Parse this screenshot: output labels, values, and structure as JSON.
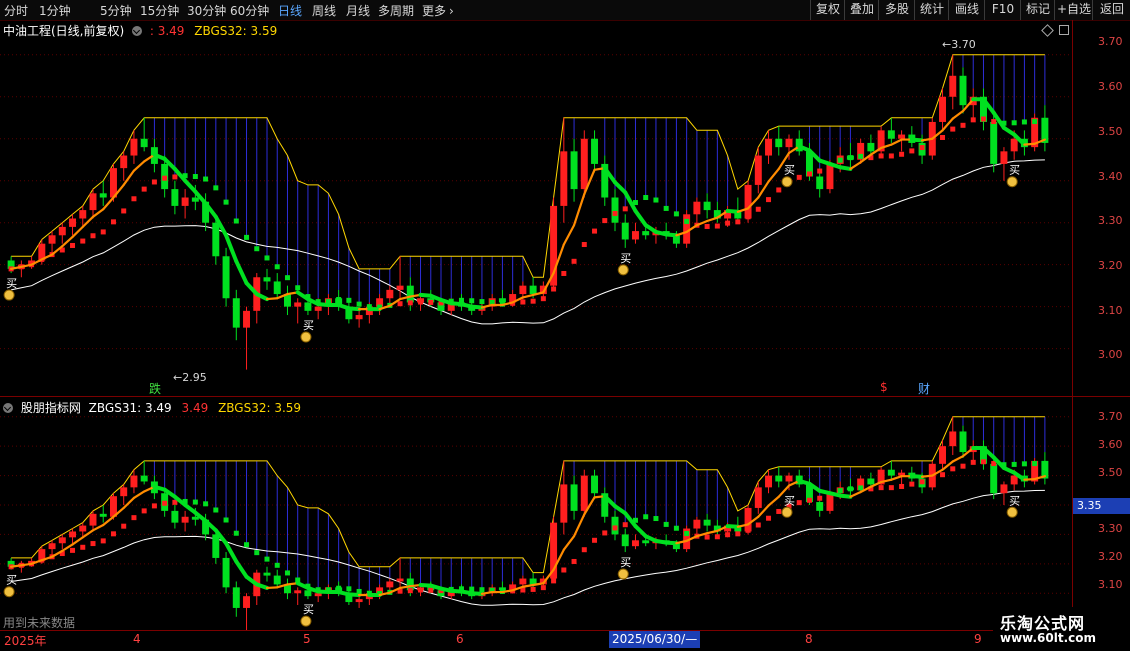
{
  "toolbar": {
    "periods": [
      "分时",
      "1分钟",
      "5分钟",
      "15分钟",
      "30分钟",
      "60分钟",
      "日线",
      "周线",
      "月线",
      "多周期",
      "更多"
    ],
    "active_period": "日线",
    "tools": [
      "复权",
      "叠加",
      "多股",
      "统计",
      "画线",
      "F10",
      "+自选",
      "返回"
    ],
    "more_icon": "chevron-right-icon"
  },
  "main_pane": {
    "title": "中油工程(日线,前复权)",
    "value_a": ": 3.49",
    "indicator_b": "ZBGS32: 3.59",
    "high_label": "3.70",
    "low_label": "2.95",
    "markers": {
      "fall": "跌",
      "dollar": "$",
      "finance": "财"
    },
    "axis": [
      "3.70",
      "3.60",
      "3.50",
      "3.40",
      "3.30",
      "3.20",
      "3.10",
      "3.00"
    ]
  },
  "sub_pane": {
    "title": "股朋指标网",
    "indicator_a": "ZBGS31: 3.49",
    "value_mid": "3.49",
    "indicator_b": "ZBGS32: 3.59",
    "axis": [
      "3.70",
      "3.60",
      "3.50",
      "3.40",
      "3.30",
      "3.20",
      "3.10"
    ],
    "current_price": "3.35",
    "note": "用到未来数据"
  },
  "signal_buy": "买",
  "time_axis": {
    "labels": [
      "2025年",
      "4",
      "5",
      "6",
      "8",
      "9"
    ],
    "cursor_date": "2025/06/30/—"
  },
  "watermark": {
    "name": "乐淘公式网",
    "url": "www.60lt.com"
  },
  "colors": {
    "up": "#ff1f1f",
    "down": "#00e020",
    "ma": "#ffd700",
    "band": "#2d2dd8",
    "orange": "#ff8c00",
    "axis": "#7a0000"
  },
  "chart_data": {
    "type": "candlestick",
    "series_note": "daily OHLC approximated from chart",
    "ylim_main": [
      2.93,
      3.74
    ],
    "ylim_sub": [
      3.06,
      3.74
    ],
    "ohlc": [
      [
        3.21,
        3.22,
        3.18,
        3.19
      ],
      [
        3.19,
        3.21,
        3.17,
        3.2
      ],
      [
        3.2,
        3.22,
        3.19,
        3.21
      ],
      [
        3.21,
        3.26,
        3.2,
        3.25
      ],
      [
        3.25,
        3.28,
        3.23,
        3.27
      ],
      [
        3.27,
        3.3,
        3.25,
        3.29
      ],
      [
        3.29,
        3.32,
        3.27,
        3.31
      ],
      [
        3.31,
        3.34,
        3.29,
        3.33
      ],
      [
        3.33,
        3.38,
        3.31,
        3.37
      ],
      [
        3.37,
        3.4,
        3.34,
        3.36
      ],
      [
        3.36,
        3.44,
        3.35,
        3.43
      ],
      [
        3.43,
        3.47,
        3.4,
        3.46
      ],
      [
        3.46,
        3.52,
        3.44,
        3.5
      ],
      [
        3.5,
        3.55,
        3.47,
        3.48
      ],
      [
        3.48,
        3.5,
        3.42,
        3.44
      ],
      [
        3.44,
        3.46,
        3.36,
        3.38
      ],
      [
        3.38,
        3.4,
        3.32,
        3.34
      ],
      [
        3.34,
        3.38,
        3.31,
        3.36
      ],
      [
        3.36,
        3.39,
        3.33,
        3.35
      ],
      [
        3.35,
        3.37,
        3.28,
        3.3
      ],
      [
        3.3,
        3.32,
        3.2,
        3.22
      ],
      [
        3.22,
        3.24,
        3.1,
        3.12
      ],
      [
        3.12,
        3.14,
        3.02,
        3.05
      ],
      [
        3.05,
        3.1,
        2.95,
        3.09
      ],
      [
        3.09,
        3.18,
        3.06,
        3.17
      ],
      [
        3.17,
        3.19,
        3.14,
        3.16
      ],
      [
        3.16,
        3.18,
        3.12,
        3.13
      ],
      [
        3.13,
        3.15,
        3.08,
        3.1
      ],
      [
        3.1,
        3.12,
        3.06,
        3.11
      ],
      [
        3.11,
        3.13,
        3.08,
        3.09
      ],
      [
        3.09,
        3.12,
        3.07,
        3.1
      ],
      [
        3.1,
        3.13,
        3.08,
        3.12
      ],
      [
        3.12,
        3.14,
        3.09,
        3.1
      ],
      [
        3.1,
        3.12,
        3.06,
        3.07
      ],
      [
        3.07,
        3.1,
        3.05,
        3.08
      ],
      [
        3.08,
        3.11,
        3.06,
        3.1
      ],
      [
        3.1,
        3.13,
        3.08,
        3.12
      ],
      [
        3.12,
        3.15,
        3.1,
        3.14
      ],
      [
        3.14,
        3.22,
        3.12,
        3.15
      ],
      [
        3.15,
        3.17,
        3.09,
        3.11
      ],
      [
        3.11,
        3.13,
        3.09,
        3.12
      ],
      [
        3.12,
        3.14,
        3.1,
        3.11
      ],
      [
        3.11,
        3.12,
        3.08,
        3.09
      ],
      [
        3.09,
        3.12,
        3.08,
        3.11
      ],
      [
        3.11,
        3.13,
        3.09,
        3.1
      ],
      [
        3.1,
        3.12,
        3.08,
        3.09
      ],
      [
        3.09,
        3.11,
        3.08,
        3.1
      ],
      [
        3.1,
        3.13,
        3.09,
        3.12
      ],
      [
        3.12,
        3.14,
        3.1,
        3.11
      ],
      [
        3.11,
        3.14,
        3.1,
        3.13
      ],
      [
        3.13,
        3.16,
        3.11,
        3.15
      ],
      [
        3.15,
        3.17,
        3.12,
        3.13
      ],
      [
        3.13,
        3.16,
        3.12,
        3.15
      ],
      [
        3.15,
        3.36,
        3.14,
        3.34
      ],
      [
        3.34,
        3.55,
        3.3,
        3.47
      ],
      [
        3.47,
        3.5,
        3.35,
        3.38
      ],
      [
        3.38,
        3.52,
        3.36,
        3.5
      ],
      [
        3.5,
        3.52,
        3.42,
        3.44
      ],
      [
        3.44,
        3.46,
        3.34,
        3.36
      ],
      [
        3.36,
        3.38,
        3.28,
        3.3
      ],
      [
        3.3,
        3.32,
        3.24,
        3.26
      ],
      [
        3.26,
        3.3,
        3.25,
        3.28
      ],
      [
        3.28,
        3.3,
        3.26,
        3.27
      ],
      [
        3.27,
        3.29,
        3.25,
        3.28
      ],
      [
        3.28,
        3.3,
        3.26,
        3.27
      ],
      [
        3.27,
        3.28,
        3.24,
        3.25
      ],
      [
        3.25,
        3.33,
        3.24,
        3.32
      ],
      [
        3.32,
        3.36,
        3.3,
        3.35
      ],
      [
        3.35,
        3.37,
        3.31,
        3.33
      ],
      [
        3.33,
        3.35,
        3.3,
        3.31
      ],
      [
        3.31,
        3.34,
        3.29,
        3.33
      ],
      [
        3.33,
        3.36,
        3.3,
        3.31
      ],
      [
        3.31,
        3.4,
        3.3,
        3.39
      ],
      [
        3.39,
        3.48,
        3.37,
        3.46
      ],
      [
        3.46,
        3.52,
        3.44,
        3.5
      ],
      [
        3.5,
        3.53,
        3.46,
        3.48
      ],
      [
        3.48,
        3.51,
        3.45,
        3.5
      ],
      [
        3.5,
        3.52,
        3.46,
        3.47
      ],
      [
        3.47,
        3.49,
        3.4,
        3.41
      ],
      [
        3.41,
        3.43,
        3.36,
        3.38
      ],
      [
        3.38,
        3.45,
        3.37,
        3.44
      ],
      [
        3.44,
        3.48,
        3.42,
        3.46
      ],
      [
        3.46,
        3.49,
        3.43,
        3.45
      ],
      [
        3.45,
        3.5,
        3.44,
        3.49
      ],
      [
        3.49,
        3.51,
        3.46,
        3.47
      ],
      [
        3.47,
        3.53,
        3.46,
        3.52
      ],
      [
        3.52,
        3.55,
        3.49,
        3.5
      ],
      [
        3.5,
        3.52,
        3.47,
        3.51
      ],
      [
        3.51,
        3.53,
        3.48,
        3.49
      ],
      [
        3.49,
        3.51,
        3.44,
        3.46
      ],
      [
        3.46,
        3.55,
        3.45,
        3.54
      ],
      [
        3.54,
        3.62,
        3.52,
        3.6
      ],
      [
        3.6,
        3.7,
        3.57,
        3.65
      ],
      [
        3.65,
        3.67,
        3.56,
        3.58
      ],
      [
        3.58,
        3.62,
        3.55,
        3.6
      ],
      [
        3.6,
        3.62,
        3.52,
        3.54
      ],
      [
        3.54,
        3.56,
        3.42,
        3.44
      ],
      [
        3.44,
        3.48,
        3.4,
        3.47
      ],
      [
        3.47,
        3.52,
        3.45,
        3.5
      ],
      [
        3.5,
        3.52,
        3.46,
        3.48
      ],
      [
        3.48,
        3.56,
        3.47,
        3.55
      ],
      [
        3.55,
        3.58,
        3.47,
        3.49
      ]
    ]
  }
}
